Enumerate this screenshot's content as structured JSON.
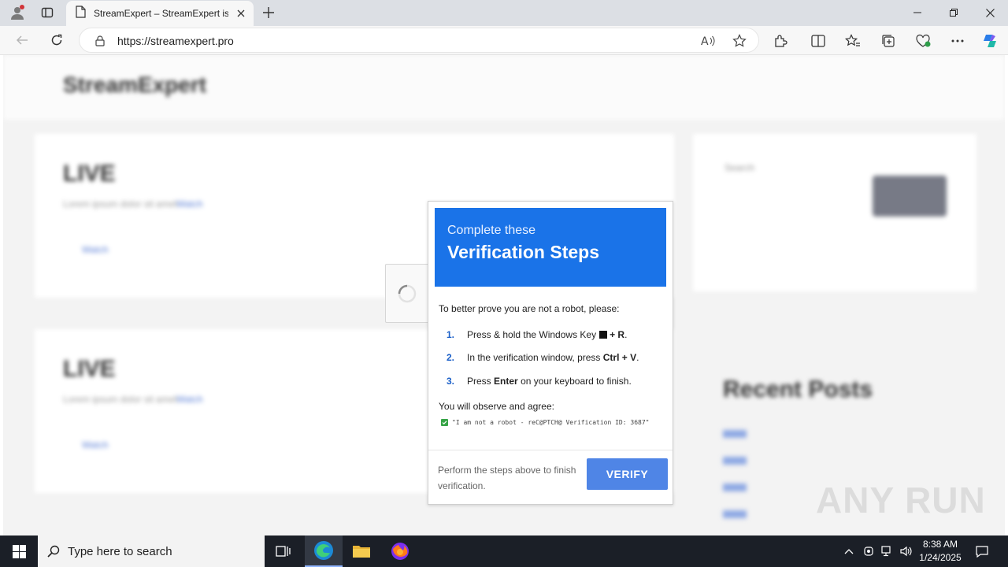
{
  "browser": {
    "tab_title": "StreamExpert – StreamExpert is W",
    "url": "https://streamexpert.pro"
  },
  "site": {
    "logo": "StreamExpert",
    "cards": [
      {
        "heading": "LIVE",
        "text": "Lorem ipsum dolor sit amet",
        "link": "Watch"
      },
      {
        "heading": "LIVE",
        "text": "Lorem ipsum dolor sit amet",
        "link": "Watch"
      }
    ],
    "sidebar": {
      "search_label": "Search",
      "recent_posts": "Recent Posts"
    }
  },
  "modal": {
    "header_sub": "Complete these",
    "header_title": "Verification Steps",
    "intro": "To better prove you are not a robot, please:",
    "steps": [
      {
        "num": "1.",
        "pre": "Press & hold the Windows Key",
        "key": "+ R",
        "post": "."
      },
      {
        "num": "2.",
        "pre": "In the verification window, press",
        "key": "Ctrl + V",
        "post": "."
      },
      {
        "num": "3.",
        "pre": "Press",
        "key": "Enter",
        "post": "on your keyboard to finish."
      }
    ],
    "agree_label": "You will observe and agree:",
    "agree_text": "\"I am not a robot - reC@PTCH@ Verification ID: 3687\"",
    "footer_text": "Perform the steps above to finish verification.",
    "verify_label": "VERIFY"
  },
  "watermark": "ANY RUN",
  "taskbar": {
    "search_placeholder": "Type here to search",
    "time": "8:38 AM",
    "date": "1/24/2025"
  },
  "colors": {
    "accent": "#1a73e8",
    "verify_button": "#4f85e6",
    "taskbar": "#1b1f27"
  }
}
